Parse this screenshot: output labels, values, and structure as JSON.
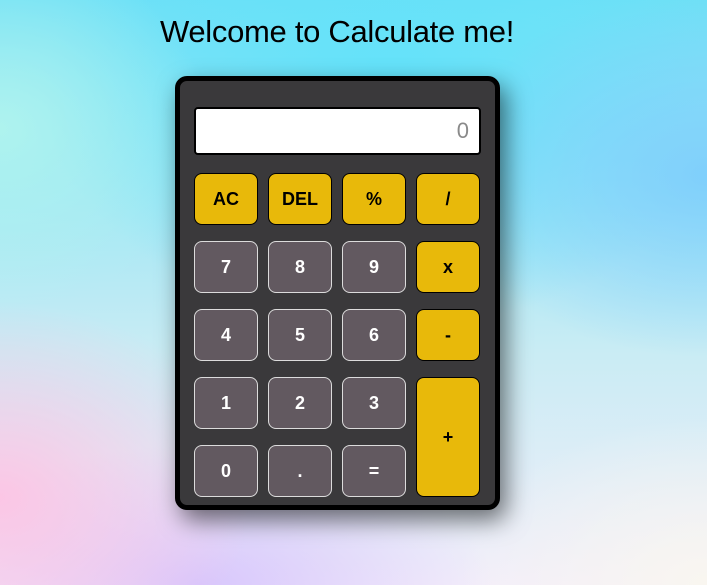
{
  "page": {
    "title": "Welcome to Calculate me!"
  },
  "calculator": {
    "display_placeholder": "0",
    "display_value": "",
    "buttons": {
      "ac": "AC",
      "del": "DEL",
      "percent": "%",
      "divide": "/",
      "seven": "7",
      "eight": "8",
      "nine": "9",
      "multiply": "x",
      "four": "4",
      "five": "5",
      "six": "6",
      "subtract": "-",
      "one": "1",
      "two": "2",
      "three": "3",
      "add": "+",
      "zero": "0",
      "decimal": ".",
      "equals": "="
    }
  },
  "colors": {
    "operator_button": "#e8b90a",
    "number_button": "#625960",
    "calculator_body": "#3a393b",
    "display_background": "#ffffff"
  }
}
